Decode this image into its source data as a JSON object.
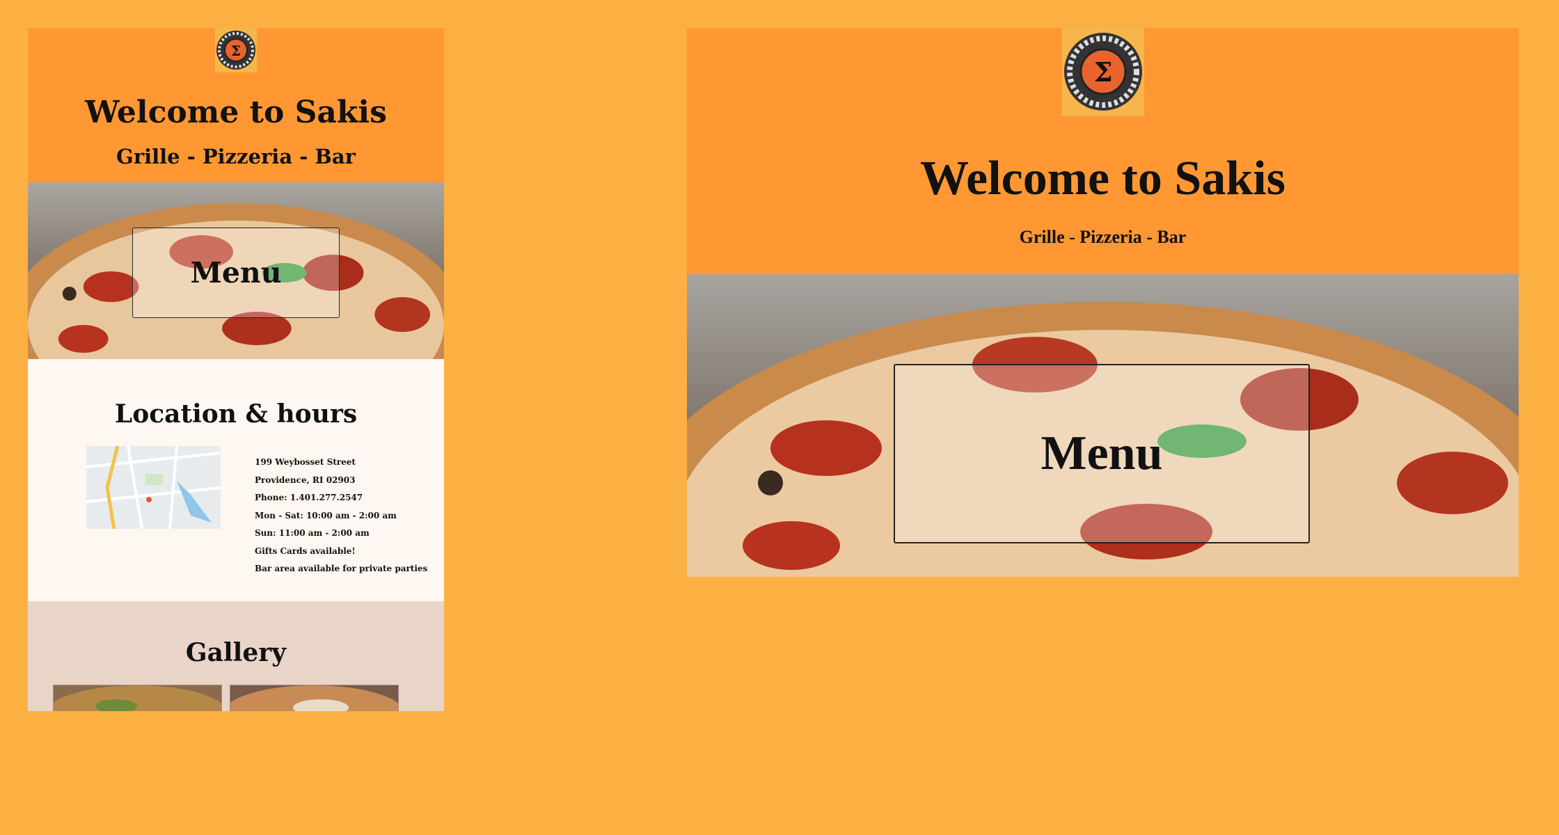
{
  "site": {
    "title": "Welcome to Sakis",
    "subtitle": "Grille - Pizzeria - Bar",
    "logo_icon": "sigma-badge-icon",
    "colors": {
      "page_background": "#fdb042",
      "header": "#ff9833",
      "location_background": "#fff7f1",
      "gallery_background": "#e8d5c8"
    }
  },
  "hero": {
    "menu_label": "Menu"
  },
  "location": {
    "heading": "Location & hours",
    "map_icon": "map-thumbnail",
    "lines": [
      "199 Weybosset Street",
      "Providence, RI 02903",
      "Phone: 1.401.277.2547",
      "Mon - Sat: 10:00 am - 2:00 am",
      "Sun: 11:00 am - 2:00 am",
      "Gifts Cards available!",
      "Bar area available for private parties"
    ]
  },
  "gallery": {
    "heading": "Gallery"
  }
}
